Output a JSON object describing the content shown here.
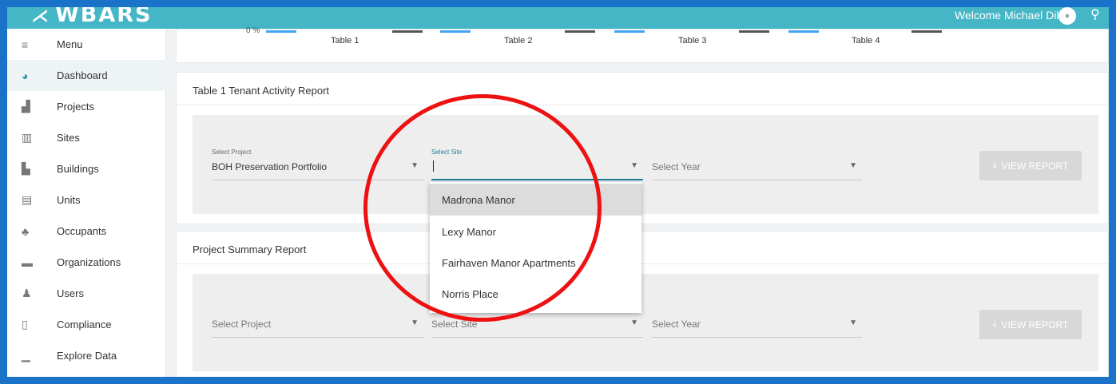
{
  "app": {
    "logo": "WBARS",
    "welcome": "Welcome Michael Dill"
  },
  "sidebar": {
    "items": [
      {
        "label": "Menu",
        "icon": "menu-icon",
        "glyph": "≡"
      },
      {
        "label": "Dashboard",
        "icon": "dashboard-icon",
        "glyph": "◕",
        "active": true
      },
      {
        "label": "Projects",
        "icon": "projects-icon",
        "glyph": "▟"
      },
      {
        "label": "Sites",
        "icon": "sites-icon",
        "glyph": "▥"
      },
      {
        "label": "Buildings",
        "icon": "buildings-icon",
        "glyph": "▙"
      },
      {
        "label": "Units",
        "icon": "units-icon",
        "glyph": "▤"
      },
      {
        "label": "Occupants",
        "icon": "occupants-icon",
        "glyph": "♣"
      },
      {
        "label": "Organizations",
        "icon": "briefcase-icon",
        "glyph": "▬"
      },
      {
        "label": "Users",
        "icon": "users-icon",
        "glyph": "♟"
      },
      {
        "label": "Compliance",
        "icon": "document-icon",
        "glyph": "▯"
      },
      {
        "label": "Explore Data",
        "icon": "chart-icon",
        "glyph": "▁"
      }
    ]
  },
  "chart_strip": {
    "y_tick": "0 %",
    "tables": [
      "Table 1",
      "Table 2",
      "Table 3",
      "Table 4"
    ],
    "colors": {
      "primary": "#42a5f5",
      "secondary": "#555555"
    }
  },
  "tenant_report": {
    "title": "Table 1 Tenant Activity Report",
    "project": {
      "label": "Select Project",
      "value": "BOH Preservation Portfolio"
    },
    "site": {
      "label": "Select Site",
      "value": ""
    },
    "year": {
      "placeholder": "Select Year"
    },
    "button": "VIEW REPORT"
  },
  "site_dropdown": {
    "options": [
      "Madrona Manor",
      "Lexy Manor",
      "Fairhaven Manor Apartments",
      "Norris Place"
    ],
    "highlighted": 0
  },
  "summary_report": {
    "title": "Project Summary Report",
    "project": {
      "placeholder": "Select Project"
    },
    "site": {
      "placeholder": "Select Site"
    },
    "year": {
      "placeholder": "Select Year"
    },
    "button": "VIEW REPORT"
  }
}
